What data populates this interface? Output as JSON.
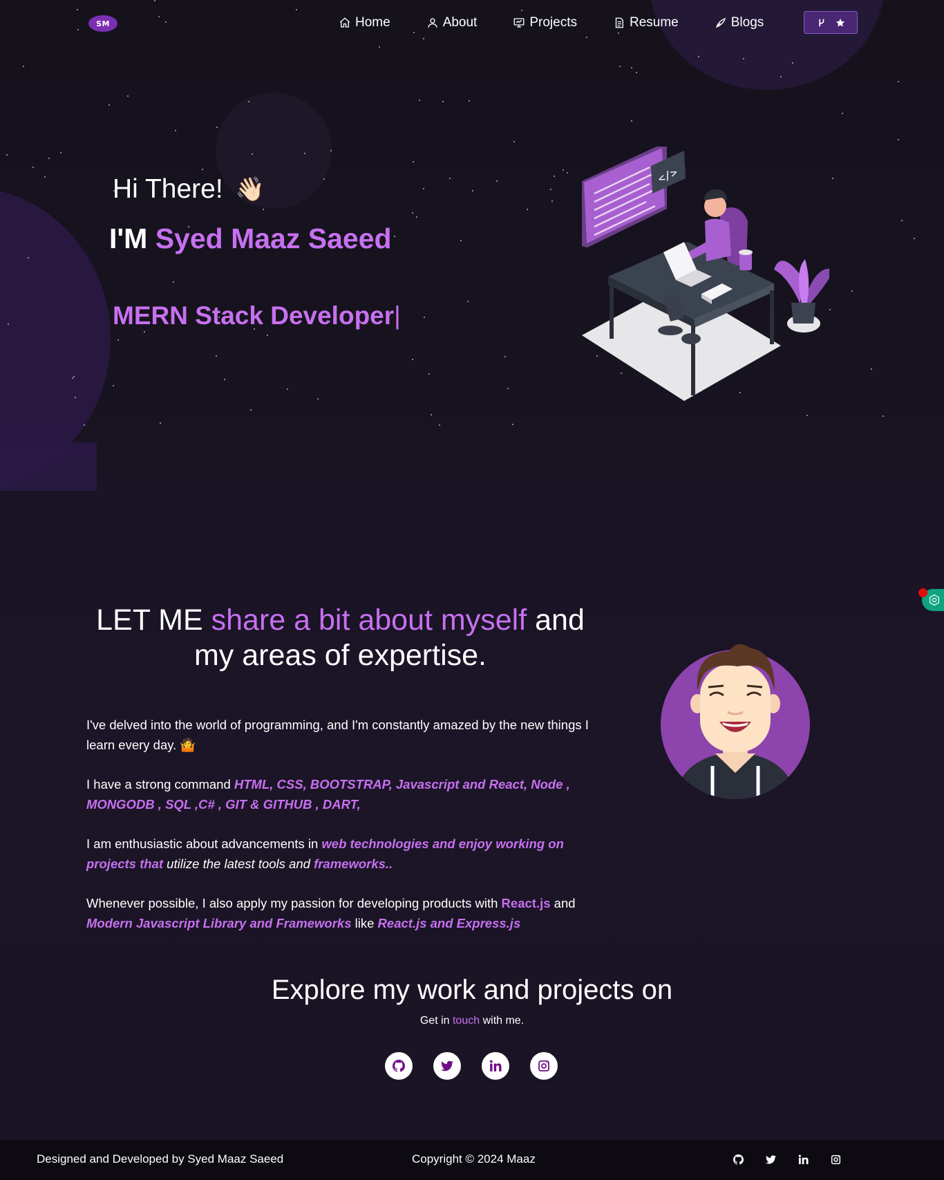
{
  "nav": {
    "logo": "SM",
    "items": [
      {
        "label": "Home",
        "icon": "home-icon"
      },
      {
        "label": "About",
        "icon": "user-icon"
      },
      {
        "label": "Projects",
        "icon": "projects-icon"
      },
      {
        "label": "Resume",
        "icon": "document-icon"
      },
      {
        "label": "Blogs",
        "icon": "blogs-icon"
      }
    ],
    "fork_button": {
      "icons": [
        "fork-icon",
        "star-icon"
      ]
    }
  },
  "hero": {
    "greeting": "Hi There!",
    "wave": "👋🏻",
    "im_prefix": "I'M",
    "name": "Syed Maaz Saeed",
    "role": "MERN Stack Developer",
    "cursor": "|"
  },
  "about": {
    "heading_part1": "LET ME",
    "heading_highlight": "share a bit about myself",
    "heading_part2": "and my areas of expertise.",
    "p1_text": "I've delved into the world of programming, and I'm constantly amazed by the new things I learn every day.",
    "p1_emoji": "🤷",
    "p2_text": "I have a strong command",
    "p2_skills": "HTML, CSS, BOOTSTRAP, Javascript and React, Node , MONGODB , SQL ,C# , GIT & GITHUB , DART,",
    "p3_text": "I am enthusiastic about advancements in",
    "p3_highlight": "web technologies and enjoy working on projects that",
    "p3_italic": "utilize the latest tools and",
    "p3_highlight2": "frameworks..",
    "p4_text": "Whenever possible, I also apply my passion for developing products with",
    "p4_highlight": "React.js",
    "p4_and": "and",
    "p4_highlight2": "Modern Javascript Library and Frameworks",
    "p4_like": "like",
    "p4_highlight3": "React.js and Express.js"
  },
  "find": {
    "heading": "Explore my work and projects on",
    "touch_prefix": "Get in",
    "touch_highlight": "touch",
    "touch_suffix": "with me.",
    "socials": [
      "github-icon",
      "twitter-icon",
      "linkedin-icon",
      "instagram-icon"
    ]
  },
  "footer": {
    "designed_by": "Designed and Developed by Syed Maaz Saeed",
    "copyright": "Copyright © 2024 Maaz",
    "icons": [
      "github-icon",
      "twitter-icon",
      "linkedin-icon",
      "instagram-icon"
    ]
  },
  "colors": {
    "accent": "#c770f0",
    "background": "#131019",
    "social_icon": "#700c86",
    "fork_button": "#4a2773"
  }
}
